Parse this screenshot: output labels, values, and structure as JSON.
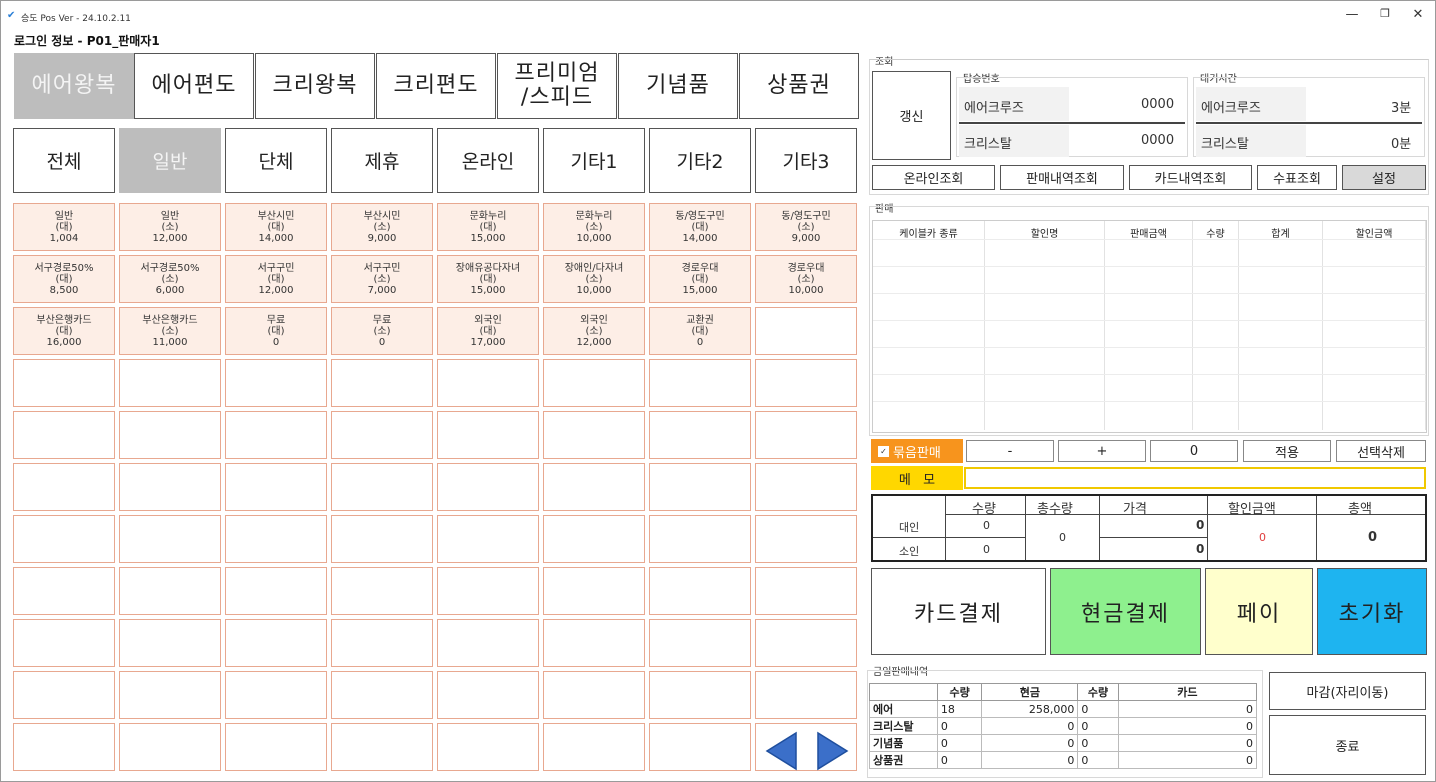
{
  "window": {
    "title": "승도 Pos Ver - 24.10.2.11",
    "login_info": "로그인 정보 - P01_판매자1",
    "controls": {
      "minimize": "—",
      "maximize": "❐",
      "close": "✕"
    }
  },
  "categories": [
    {
      "label": "에어왕복",
      "active": true
    },
    {
      "label": "에어편도",
      "active": false
    },
    {
      "label": "크리왕복",
      "active": false
    },
    {
      "label": "크리편도",
      "active": false
    },
    {
      "label": "프리미엄\n/스피드",
      "active": false
    },
    {
      "label": "기념품",
      "active": false
    },
    {
      "label": "상품권",
      "active": false
    }
  ],
  "subcategories": [
    {
      "label": "전체",
      "active": false
    },
    {
      "label": "일반",
      "active": true
    },
    {
      "label": "단체",
      "active": false
    },
    {
      "label": "제휴",
      "active": false
    },
    {
      "label": "온라인",
      "active": false
    },
    {
      "label": "기타1",
      "active": false
    },
    {
      "label": "기타2",
      "active": false
    },
    {
      "label": "기타3",
      "active": false
    }
  ],
  "tiles": [
    {
      "name": "일반",
      "type": "(대)",
      "price": "1,004"
    },
    {
      "name": "일반",
      "type": "(소)",
      "price": "12,000"
    },
    {
      "name": "부산시민",
      "type": "(대)",
      "price": "14,000"
    },
    {
      "name": "부산시민",
      "type": "(소)",
      "price": "9,000"
    },
    {
      "name": "문화누리",
      "type": "(대)",
      "price": "15,000"
    },
    {
      "name": "문화누리",
      "type": "(소)",
      "price": "10,000"
    },
    {
      "name": "동/영도구민",
      "type": "(대)",
      "price": "14,000"
    },
    {
      "name": "동/영도구민",
      "type": "(소)",
      "price": "9,000"
    },
    {
      "name": "서구경로50%",
      "type": "(대)",
      "price": "8,500"
    },
    {
      "name": "서구경로50%",
      "type": "(소)",
      "price": "6,000"
    },
    {
      "name": "서구구민",
      "type": "(대)",
      "price": "12,000"
    },
    {
      "name": "서구구민",
      "type": "(소)",
      "price": "7,000"
    },
    {
      "name": "장애유공다자녀",
      "type": "(대)",
      "price": "15,000"
    },
    {
      "name": "장애인/다자녀",
      "type": "(소)",
      "price": "10,000"
    },
    {
      "name": "경로우대",
      "type": "(대)",
      "price": "15,000"
    },
    {
      "name": "경로우대",
      "type": "(소)",
      "price": "10,000"
    },
    {
      "name": "부산은행카드",
      "type": "(대)",
      "price": "16,000"
    },
    {
      "name": "부산은행카드",
      "type": "(소)",
      "price": "11,000"
    },
    {
      "name": "무료",
      "type": "(대)",
      "price": "0"
    },
    {
      "name": "무료",
      "type": "(소)",
      "price": "0"
    },
    {
      "name": "외국인",
      "type": "(대)",
      "price": "17,000"
    },
    {
      "name": "외국인",
      "type": "(소)",
      "price": "12,000"
    },
    {
      "name": "교환권",
      "type": "(대)",
      "price": "0"
    }
  ],
  "nav": {
    "prev": "prev-arrow-icon",
    "next": "next-arrow-icon",
    "color": "#3b6fc9"
  },
  "lookup": {
    "group_label": "조회",
    "refresh": "갱신",
    "boarding_label": "탑승번호",
    "wait_label": "대기시간",
    "boarding": [
      {
        "name": "에어크루즈",
        "value": "0000"
      },
      {
        "name": "크리스탈",
        "value": "0000"
      }
    ],
    "wait": [
      {
        "name": "에어크루즈",
        "value": "3분"
      },
      {
        "name": "크리스탈",
        "value": "0분"
      }
    ],
    "buttons": [
      "온라인조회",
      "판매내역조회",
      "카드내역조회",
      "수표조회",
      "설정"
    ]
  },
  "sales": {
    "group_label": "판매",
    "columns": [
      "케이블카 종류",
      "할인명",
      "판매금액",
      "수량",
      "합계",
      "할인금액"
    ],
    "bundle_label": "묶음판매",
    "bundle_checked": true,
    "minus": "-",
    "plus": "+",
    "qty": "0",
    "apply": "적용",
    "delete": "선택삭제",
    "memo_label": "메   모",
    "memo_value": ""
  },
  "summary": {
    "headers": [
      "수량",
      "총수량",
      "가격",
      "할인금액",
      "총액"
    ],
    "rows": [
      {
        "label": "대인",
        "qty": "0",
        "price": "0"
      },
      {
        "label": "소인",
        "qty": "0",
        "price": "0"
      }
    ],
    "total_qty": "0",
    "discount": "0",
    "total": "0"
  },
  "payment": {
    "card": "카드결제",
    "cash": "현금결제",
    "pay": "페이",
    "reset": "초기화",
    "colors": {
      "cash": "#8ef08e",
      "pay": "#ffffcc",
      "reset": "#1eb4f0"
    }
  },
  "daily": {
    "group_label": "금일판매내역",
    "headers": [
      "",
      "수량",
      "현금",
      "수량",
      "카드"
    ],
    "rows": [
      {
        "item": "에어",
        "qty": "18",
        "cash": "258,000",
        "card_qty": "0",
        "card": "0"
      },
      {
        "item": "크리스탈",
        "qty": "0",
        "cash": "0",
        "card_qty": "0",
        "card": "0"
      },
      {
        "item": "기념품",
        "qty": "0",
        "cash": "0",
        "card_qty": "0",
        "card": "0"
      },
      {
        "item": "상품권",
        "qty": "0",
        "cash": "0",
        "card_qty": "0",
        "card": "0"
      }
    ],
    "close_seat": "마감(자리이동)",
    "exit": "종료"
  }
}
